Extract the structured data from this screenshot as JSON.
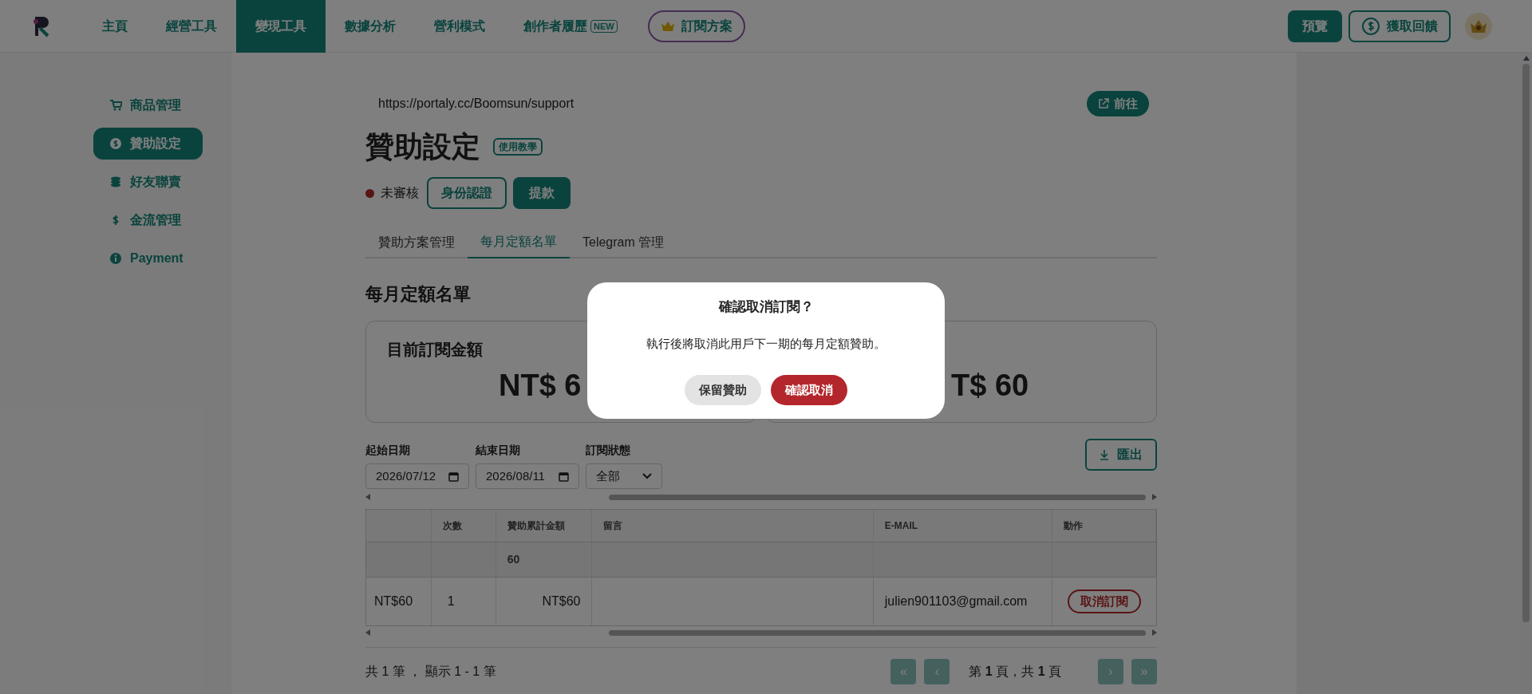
{
  "nav": {
    "items": [
      {
        "label": "主頁",
        "selected": false
      },
      {
        "label": "經營工具",
        "selected": false
      },
      {
        "label": "變現工具",
        "selected": true
      },
      {
        "label": "數據分析",
        "selected": false
      },
      {
        "label": "營利模式",
        "selected": false
      },
      {
        "label": "創作者履歷",
        "selected": false,
        "badge": "NEW"
      }
    ],
    "plan_button": "訂閱方案",
    "preview_button": "預覽",
    "feedback_button": "獲取回饋"
  },
  "sidebar": {
    "items": [
      {
        "label": "商品管理",
        "selected": false
      },
      {
        "label": "贊助設定",
        "selected": true
      },
      {
        "label": "好友聯賣",
        "selected": false
      },
      {
        "label": "金流管理",
        "selected": false
      },
      {
        "label": "Payment",
        "selected": false
      }
    ]
  },
  "page": {
    "url": "https://portaly.cc/Boomsun/support",
    "go_button": "前往",
    "title": "贊助設定",
    "tutorial_badge": "使用教學",
    "status": "未審核",
    "verify_button": "身份認證",
    "withdraw_button": "提款"
  },
  "tabs": [
    {
      "label": "贊助方案管理",
      "selected": false
    },
    {
      "label": "每月定額名單",
      "selected": true
    },
    {
      "label": "Telegram 管理",
      "selected": false
    }
  ],
  "section_title": "每月定額名單",
  "stats": [
    {
      "label": "目前訂閱金額",
      "value": "NT$ 6"
    },
    {
      "value": "T$ 60"
    }
  ],
  "filters": [
    {
      "label": "起始日期",
      "value": "2026/07/12",
      "kind": "date"
    },
    {
      "label": "結束日期",
      "value": "2026/08/11",
      "kind": "date"
    },
    {
      "label": "訂閱狀態",
      "value": "全部",
      "kind": "select"
    }
  ],
  "export_button": "匯出",
  "table": {
    "columns": [
      "次數",
      "贊助累計金額",
      "留言",
      "E-MAIL",
      "動作"
    ],
    "summary_row": {
      "total_amount": "60"
    },
    "rows": [
      {
        "column_1": "NT$60",
        "count": "1",
        "total_amount": "NT$60",
        "email": "julien901103@gmail.com",
        "action": "取消訂閱"
      }
    ]
  },
  "footer": {
    "summary": "共 1 筆 ， 顯示 1 - 1 筆",
    "page_info": "第 **1** 頁，共 **1** 頁",
    "pager": [
      {
        "label": "«",
        "disabled": true
      },
      {
        "label": "‹",
        "disabled": true
      },
      {
        "label": "›",
        "disabled": true
      },
      {
        "label": "»",
        "disabled": true
      }
    ]
  },
  "dialog": {
    "title": "確認取消訂閱？",
    "message": "執行後將取消此用戶下一期的每月定額贊助。",
    "buttons": [
      {
        "label": "保留贊助",
        "kind": "secondary"
      },
      {
        "label": "確認取消",
        "kind": "danger"
      }
    ]
  }
}
